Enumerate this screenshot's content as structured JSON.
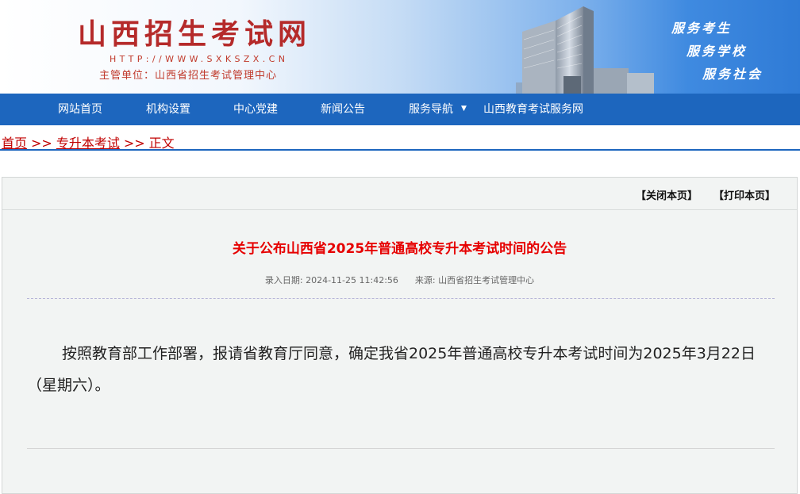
{
  "header": {
    "site_title": "山西招生考试网",
    "url": "HTTP://WWW.SXKSZX.CN",
    "owner": "主管单位：山西省招生考试管理中心",
    "slogans": [
      "服务考生",
      "服务学校",
      "服务社会"
    ]
  },
  "nav": {
    "items": [
      {
        "label": "网站首页"
      },
      {
        "label": "机构设置"
      },
      {
        "label": "中心党建"
      },
      {
        "label": "新闻公告"
      },
      {
        "label": "服务导航",
        "caret": "▼"
      },
      {
        "label": "山西教育考试服务网"
      }
    ]
  },
  "breadcrumb": {
    "home": "首页",
    "category": "专升本考试",
    "current": "正文",
    "separator": ">>"
  },
  "toolbar": {
    "close_label": "【关闭本页】",
    "print_label": "【打印本页】"
  },
  "article": {
    "title": "关于公布山西省2025年普通高校专升本考试时间的公告",
    "date_label": "录入日期:",
    "date": "2024-11-25 11:42:56",
    "source_label": "来源:",
    "source": "山西省招生考试管理中心",
    "body": "按照教育部工作部署，报请省教育厅同意，确定我省2025年普通高校专升本考试时间为2025年3月22日（星期六）。"
  },
  "colors": {
    "nav_bg": "#1d66be",
    "title_red": "#e60000",
    "breadcrumb_red": "#c00000",
    "site_title_red": "#b52a2a",
    "article_bg": "#f2f4f3"
  }
}
